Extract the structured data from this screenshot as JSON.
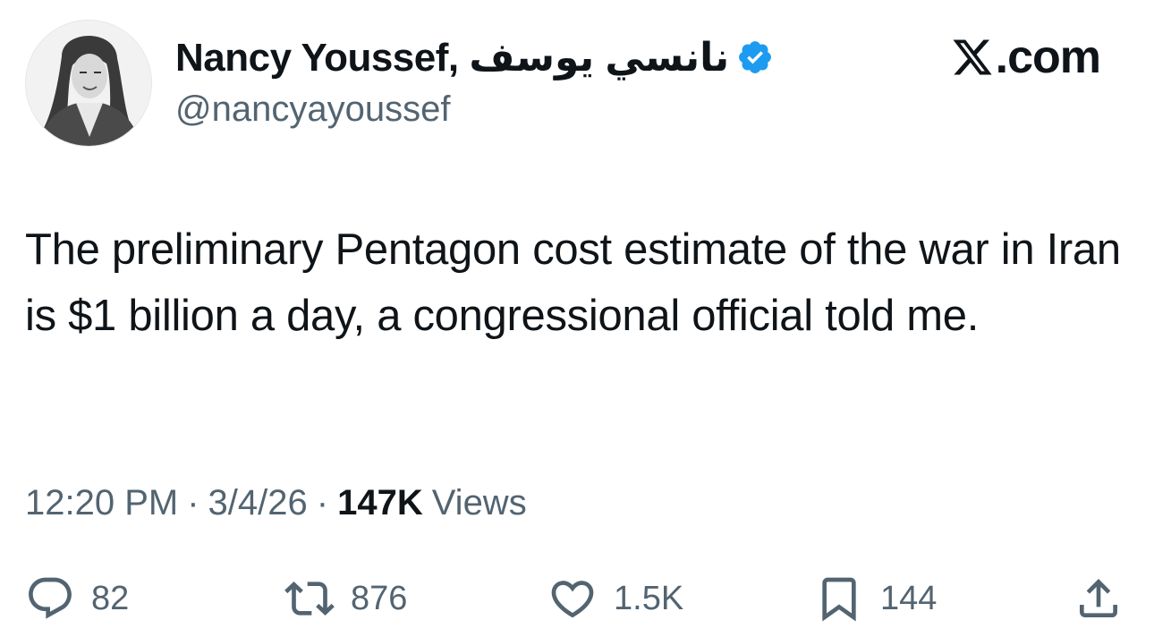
{
  "author": {
    "display_name": "Nancy Youssef, نانسي يوسف",
    "handle": "@nancyayoussef",
    "verified_badge": "verified-badge-icon",
    "verified_color": "#1d9bf0"
  },
  "brand": {
    "icon": "x-logo-icon",
    "suffix": ".com"
  },
  "tweet": {
    "text": "The preliminary Pentagon cost estimate of the war in Iran is $1 billion a day, a congressional official told me."
  },
  "meta": {
    "time": "12:20 PM",
    "separator": "·",
    "date": "3/4/26",
    "views_count": "147K",
    "views_label": "Views"
  },
  "actions": {
    "replies": "82",
    "reposts": "876",
    "likes": "1.5K",
    "bookmarks": "144"
  },
  "colors": {
    "text_primary": "#0f1419",
    "text_secondary": "#536471",
    "background": "#ffffff"
  }
}
